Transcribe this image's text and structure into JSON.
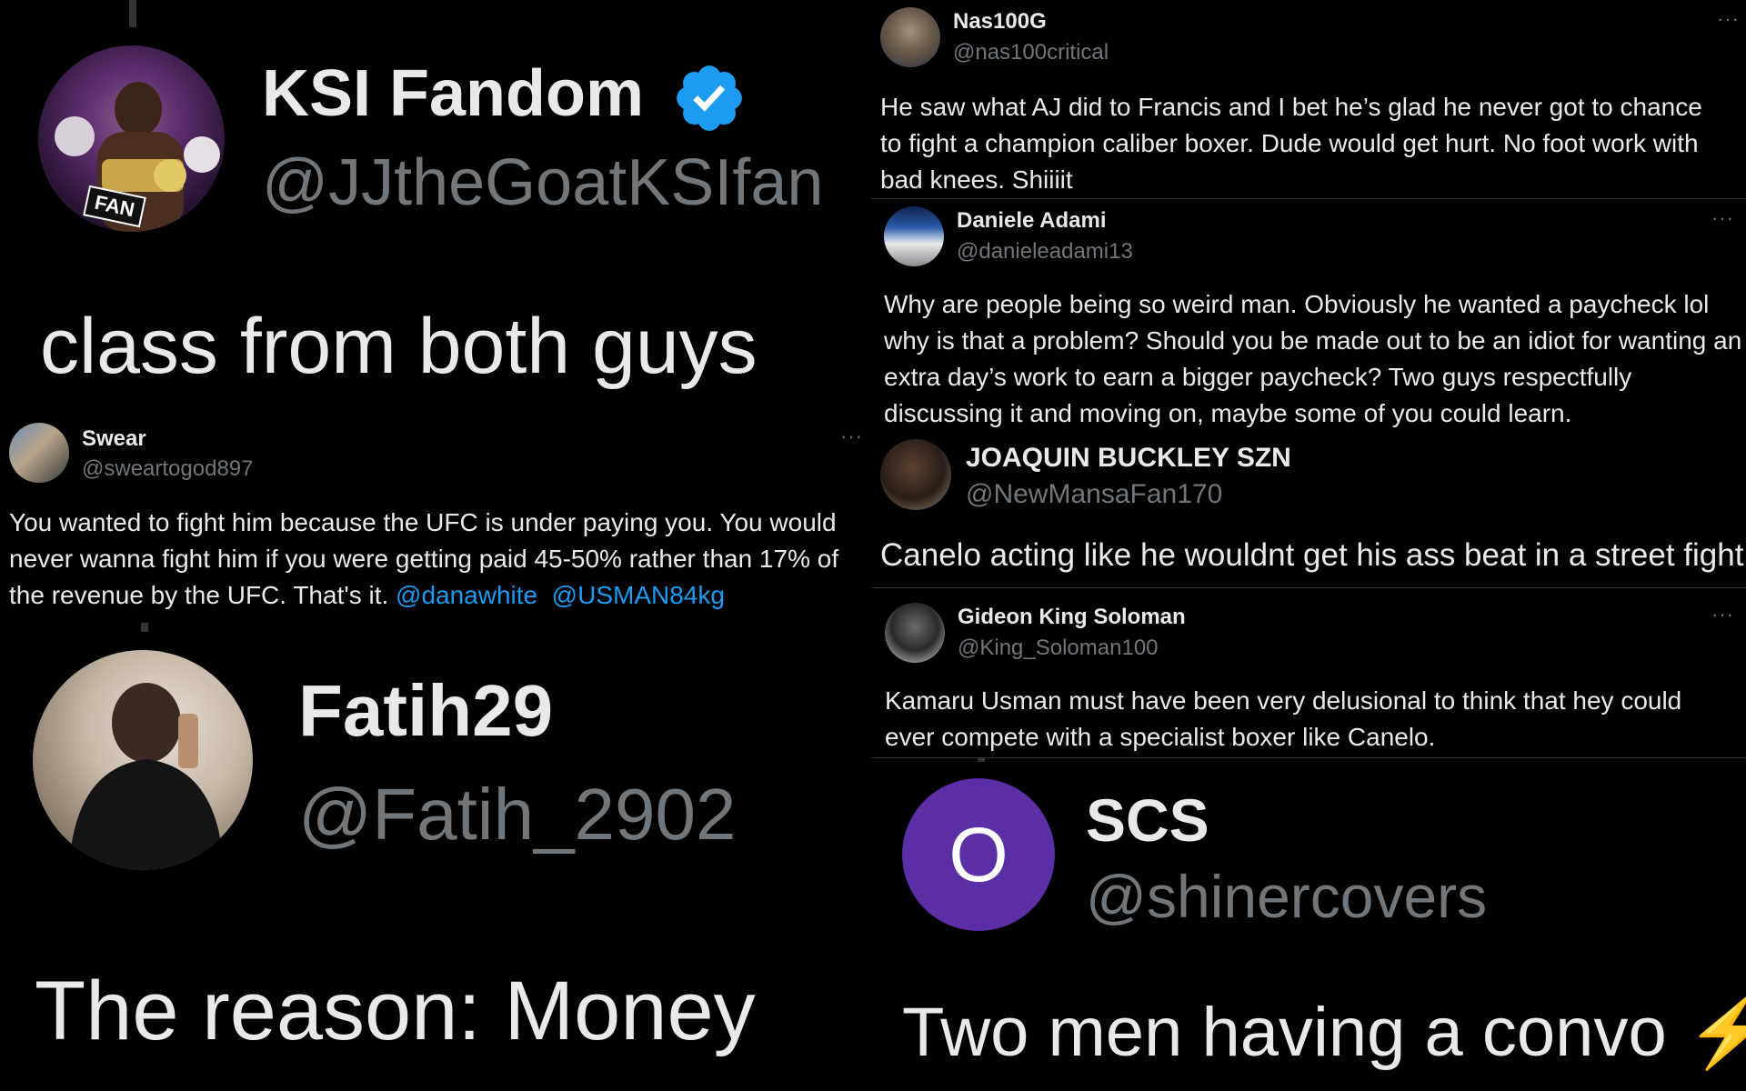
{
  "tweets": {
    "ksi": {
      "name": "KSI Fandom",
      "handle": "@JJtheGoatKSIfan",
      "text": "class from both guys",
      "avatar_badge": "FAN",
      "verified_icon": "verified-badge-icon",
      "verified_color": "#1d9bf0"
    },
    "swear": {
      "name": "Swear",
      "handle": "@sweartogod897",
      "text_before": "You wanted to fight him because the UFC is under paying you. You would never wanna fight him if you were getting paid 45-50% rather than 17% of the revenue by the UFC. That's it. ",
      "mention1": "@danawhite",
      "mention2": "@USMAN84kg",
      "more": "···"
    },
    "fatih": {
      "name": "Fatih29",
      "handle": "@Fatih_2902",
      "text": "The reason: Money"
    },
    "nas": {
      "name": "Nas100G",
      "handle": "@nas100critical",
      "text": "He saw what AJ did to Francis and I bet he’s glad he never got to chance to fight a champion caliber boxer. Dude would get hurt. No foot work with bad knees. Shiiiit",
      "more": "···"
    },
    "daniele": {
      "name": "Daniele Adami",
      "handle": "@danieleadami13",
      "text": "Why are people being so weird man. Obviously he wanted a paycheck lol why is that a problem? Should you be made out to be an idiot for wanting an extra day’s work to earn a bigger paycheck? Two guys respectfully discussing it and moving on, maybe some of you could learn.",
      "more": "···"
    },
    "joaquin": {
      "name": "JOAQUIN BUCKLEY SZN",
      "handle": "@NewMansaFan170",
      "text": "Canelo acting like he wouldnt get his ass beat in a street fight"
    },
    "gideon": {
      "name": "Gideon King Soloman",
      "handle": "@King_Soloman100",
      "text": "Kamaru Usman must have been very delusional to think that hey could ever compete with a specialist boxer like Canelo.",
      "more": "···"
    },
    "scs": {
      "name": "SCS",
      "handle": "@shinercovers",
      "avatar_letter": "O",
      "avatar_color": "#5b2ea6",
      "text": "Two men having a convo ⚡"
    }
  },
  "colors": {
    "background": "#000000",
    "text": "#e7e9ea",
    "secondary": "#71767b",
    "link": "#1d9bf0"
  }
}
